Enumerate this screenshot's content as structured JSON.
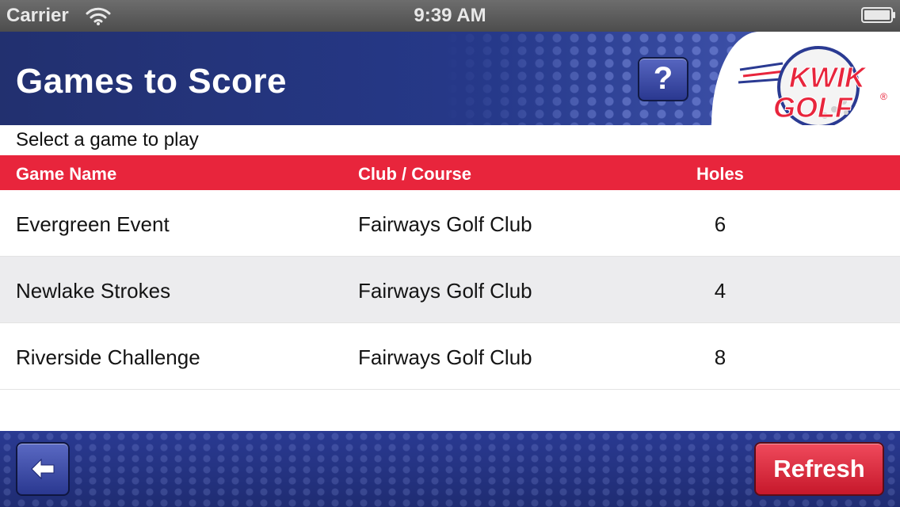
{
  "status_bar": {
    "carrier": "Carrier",
    "time": "9:39 AM",
    "wifi_icon": "wifi-icon",
    "battery_icon": "battery-icon"
  },
  "header": {
    "title": "Games to Score",
    "help_label": "?",
    "logo": {
      "line1": "KWIK",
      "line2": "GOLF",
      "mark": "®"
    },
    "colors": {
      "navy": "#26398a",
      "brand_red": "#e8253c"
    }
  },
  "subtitle": "Select a game to play",
  "table": {
    "columns": [
      "Game Name",
      "Club / Course",
      "Holes"
    ],
    "rows": [
      {
        "name": "Evergreen Event",
        "club": "Fairways Golf Club",
        "holes": "6"
      },
      {
        "name": "Newlake Strokes",
        "club": "Fairways Golf Club",
        "holes": "4"
      },
      {
        "name": "Riverside Challenge",
        "club": "Fairways Golf Club",
        "holes": "8"
      }
    ]
  },
  "footer": {
    "back_icon": "back-arrow-icon",
    "refresh_label": "Refresh"
  }
}
